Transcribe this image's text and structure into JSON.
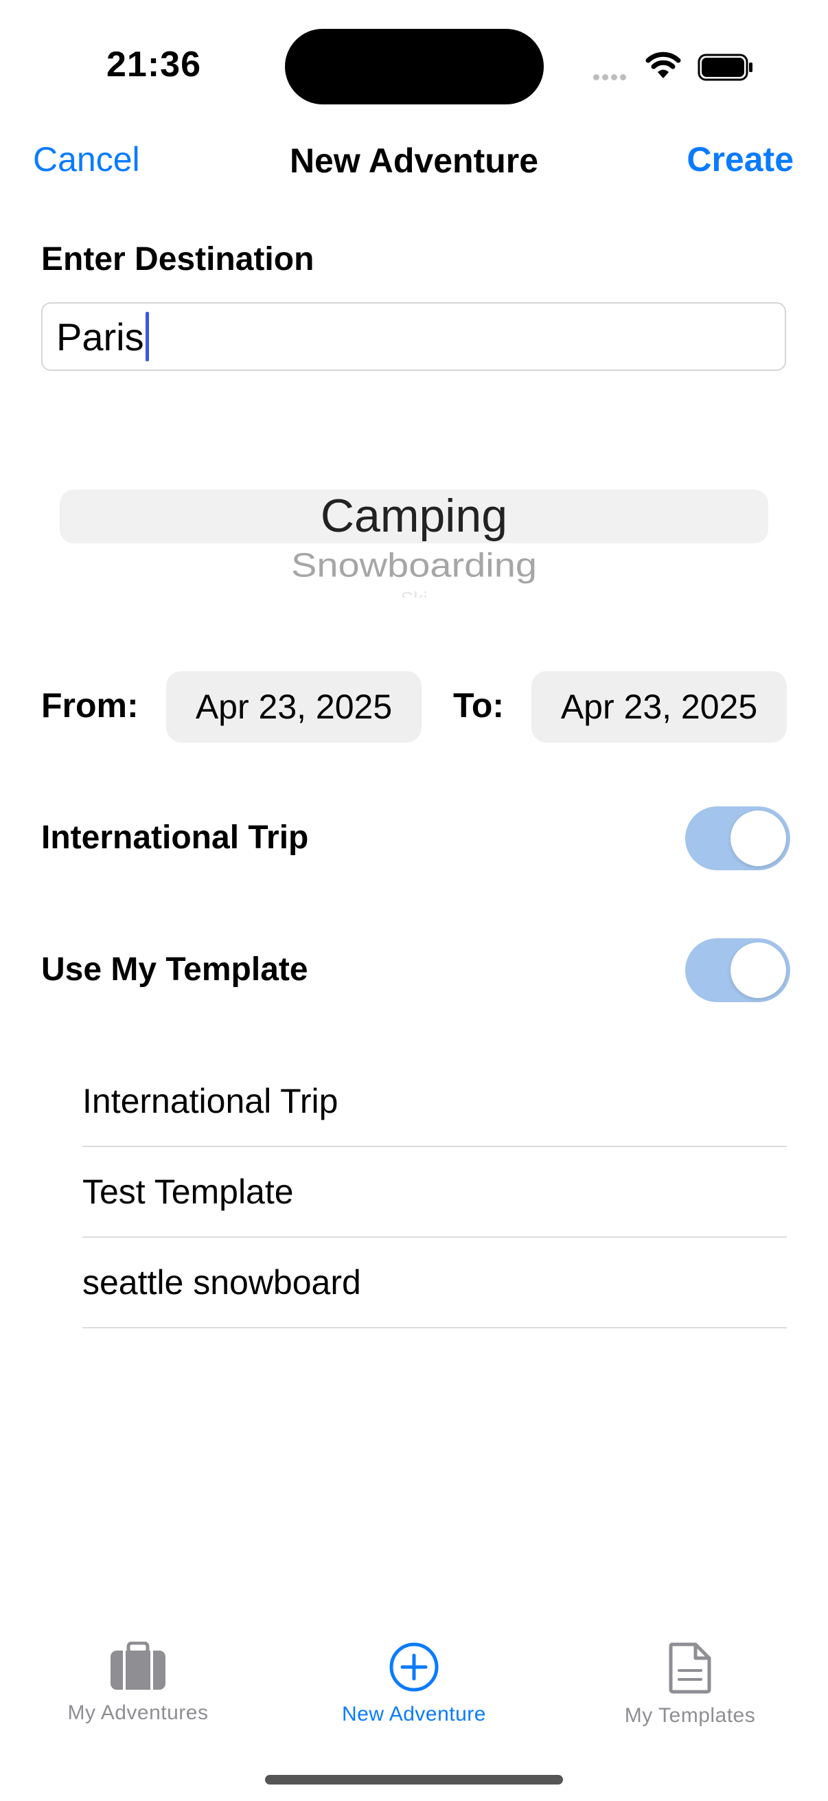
{
  "status_bar": {
    "time": "21:36"
  },
  "nav": {
    "cancel_label": "Cancel",
    "title": "New Adventure",
    "create_label": "Create"
  },
  "destination": {
    "label": "Enter Destination",
    "value": "Paris"
  },
  "activity_picker": {
    "items": [
      "Camping",
      "Snowboarding",
      "Ski"
    ],
    "selected": "Camping"
  },
  "dates": {
    "from_label": "From:",
    "from_value": "Apr 23, 2025",
    "to_label": "To:",
    "to_value": "Apr 23, 2025"
  },
  "toggles": {
    "international": {
      "label": "International Trip",
      "on": true
    },
    "template": {
      "label": "Use My Template",
      "on": true
    }
  },
  "templates": [
    "International Trip",
    "Test Template",
    "seattle snowboard"
  ],
  "tabbar": {
    "items": [
      {
        "label": "My Adventures",
        "icon": "suitcase-icon",
        "active": false
      },
      {
        "label": "New Adventure",
        "icon": "plus-circle-icon",
        "active": true
      },
      {
        "label": "My Templates",
        "icon": "document-icon",
        "active": false
      }
    ]
  },
  "colors": {
    "accent": "#0a7bff",
    "toggle_on": "#a3c4ec",
    "inactive_tab": "#8e8e93"
  }
}
